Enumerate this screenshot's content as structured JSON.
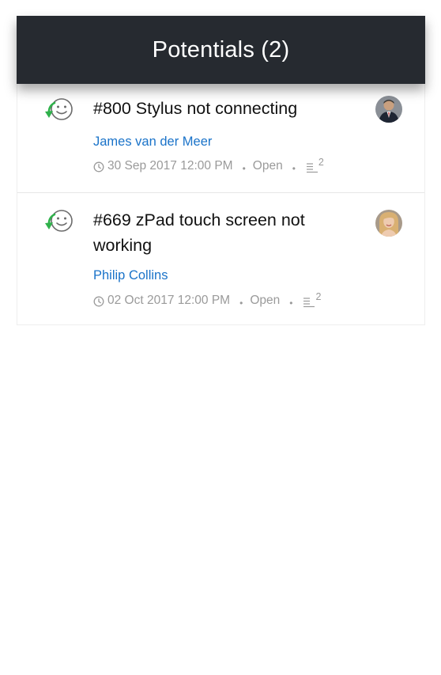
{
  "header": {
    "title": "Potentials (2)"
  },
  "items": [
    {
      "title": "#800 Stylus not connecting",
      "contact": "James van der Meer",
      "due": "30 Sep 2017 12:00 PM",
      "status": "Open",
      "note_count": "2",
      "status_icon": "customer-happiness-icon",
      "avatar": "avatar-man-suit"
    },
    {
      "title": "#669 zPad touch screen not working",
      "contact": "Philip Collins",
      "due": "02 Oct 2017 12:00 PM",
      "status": "Open",
      "note_count": "2",
      "status_icon": "customer-happiness-icon",
      "avatar": "avatar-woman-blonde"
    }
  ],
  "colors": {
    "header_bg": "#262a30",
    "link": "#1a73c9",
    "muted": "#9a9a9a",
    "accent_green": "#2fb14b"
  }
}
